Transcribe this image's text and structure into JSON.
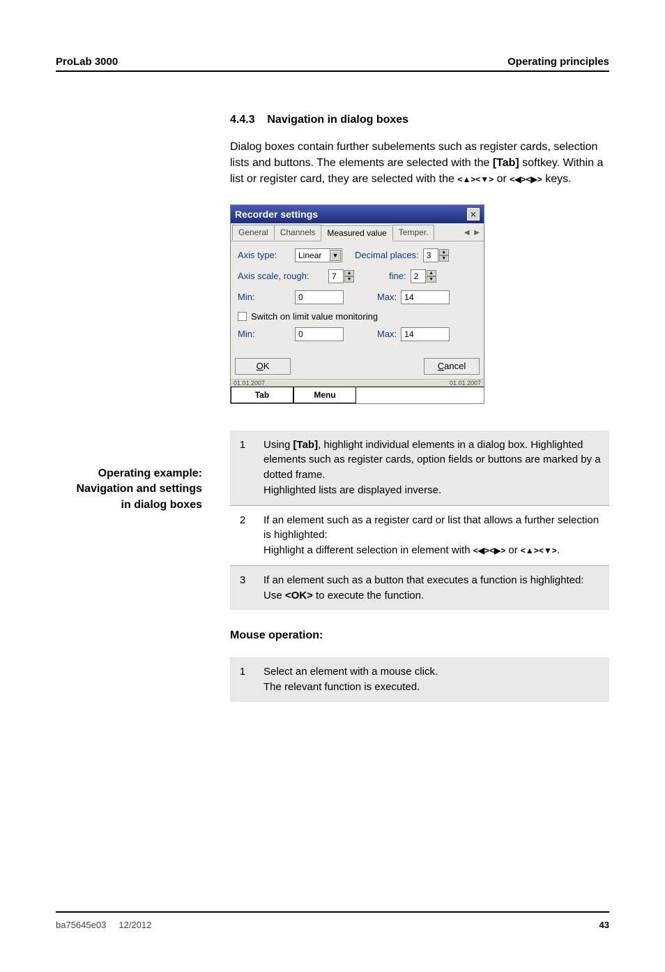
{
  "header": {
    "left": "ProLab 3000",
    "right": "Operating principles"
  },
  "section": {
    "number": "4.4.3",
    "title": "Navigation in dialog boxes",
    "paragraph_parts": {
      "p1": "Dialog boxes contain further subelements such as register cards, selection lists and buttons. The elements are selected with the ",
      "tab": "[Tab]",
      "p2": " softkey. Within a list or register card, they are selected with the ",
      "keys1a": "<▲><▼>",
      "or": " or ",
      "keys1b": "<◀><▶>",
      "p3": " keys."
    }
  },
  "dialog": {
    "title": "Recorder settings",
    "tabs": [
      "General",
      "Channels",
      "Measured value",
      "Temper."
    ],
    "active_tab": 2,
    "axis_type_label": "Axis type:",
    "axis_type_value": "Linear",
    "decimal_label": "Decimal places:",
    "decimal_value": "3",
    "axis_scale_label": "Axis scale, rough:",
    "axis_scale_value": "7",
    "fine_label": "fine:",
    "fine_value": "2",
    "min_label": "Min:",
    "min_value1": "0",
    "max_label": "Max:",
    "max_value1": "14",
    "checkbox_label": "Switch on limit value monitoring",
    "min_value2": "0",
    "max_value2": "14",
    "ok": "OK",
    "cancel": "Cancel",
    "time_left": "01.01.2007",
    "time_right": "01.01.2007",
    "softkeys": [
      "Tab",
      "Menu"
    ]
  },
  "side_caption": {
    "l1": "Operating example:",
    "l2": "Navigation and settings",
    "l3": "in dialog boxes"
  },
  "steps": [
    {
      "n": "1",
      "parts": {
        "a": "Using ",
        "b": "[Tab]",
        "c": ", highlight individual elements in a dialog box. Highlighted elements such as register cards, option fields or buttons are marked by a dotted frame.",
        "d": "Highlighted lists are displayed inverse."
      }
    },
    {
      "n": "2",
      "parts": {
        "a": "If an element such as a register card or list that allows a further selection is highlighted:",
        "b": "Highlight a different selection in element with ",
        "c": "<◀><▶>",
        "d": " or ",
        "e": "<▲><▼>",
        "f": "."
      }
    },
    {
      "n": "3",
      "parts": {
        "a": "If an element such as a button that executes a function is highlighted:",
        "b": "Use ",
        "c": "<OK>",
        "d": " to execute the function."
      }
    }
  ],
  "mouse": {
    "heading": "Mouse operation:",
    "step_n": "1",
    "step_a": "Select an element with a mouse click.",
    "step_b": "The relevant function is executed."
  },
  "footer": {
    "left1": "ba75645e03",
    "left2": "12/2012",
    "page": "43"
  }
}
